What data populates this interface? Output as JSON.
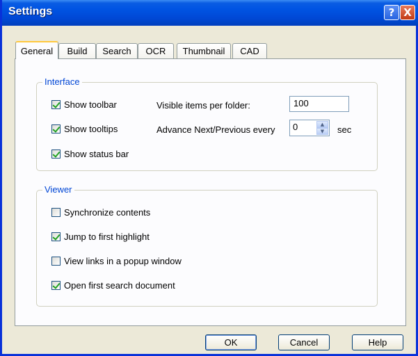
{
  "window": {
    "title": "Settings",
    "help_icon": "?",
    "close_icon": "X"
  },
  "tabs": [
    {
      "label": "General",
      "active": true
    },
    {
      "label": "Build",
      "active": false
    },
    {
      "label": "Search",
      "active": false
    },
    {
      "label": "OCR",
      "active": false
    },
    {
      "label": "Thumbnail",
      "active": false
    },
    {
      "label": "CAD",
      "active": false
    }
  ],
  "interface": {
    "legend": "Interface",
    "show_toolbar": {
      "label": "Show toolbar",
      "checked": true
    },
    "show_tooltips": {
      "label": "Show tooltips",
      "checked": true
    },
    "show_status_bar": {
      "label": "Show status bar",
      "checked": true
    },
    "visible_items": {
      "label": "Visible items per folder:",
      "value": "100"
    },
    "advance": {
      "label": "Advance Next/Previous every",
      "value": "0",
      "unit": "sec"
    }
  },
  "viewer": {
    "legend": "Viewer",
    "synchronize": {
      "label": "Synchronize contents",
      "checked": false
    },
    "jump_highlight": {
      "label": "Jump to first highlight",
      "checked": true
    },
    "popup_links": {
      "label": "View links in a popup window",
      "checked": false
    },
    "open_first": {
      "label": "Open first search document",
      "checked": true
    }
  },
  "buttons": {
    "ok": "OK",
    "cancel": "Cancel",
    "help": "Help"
  }
}
